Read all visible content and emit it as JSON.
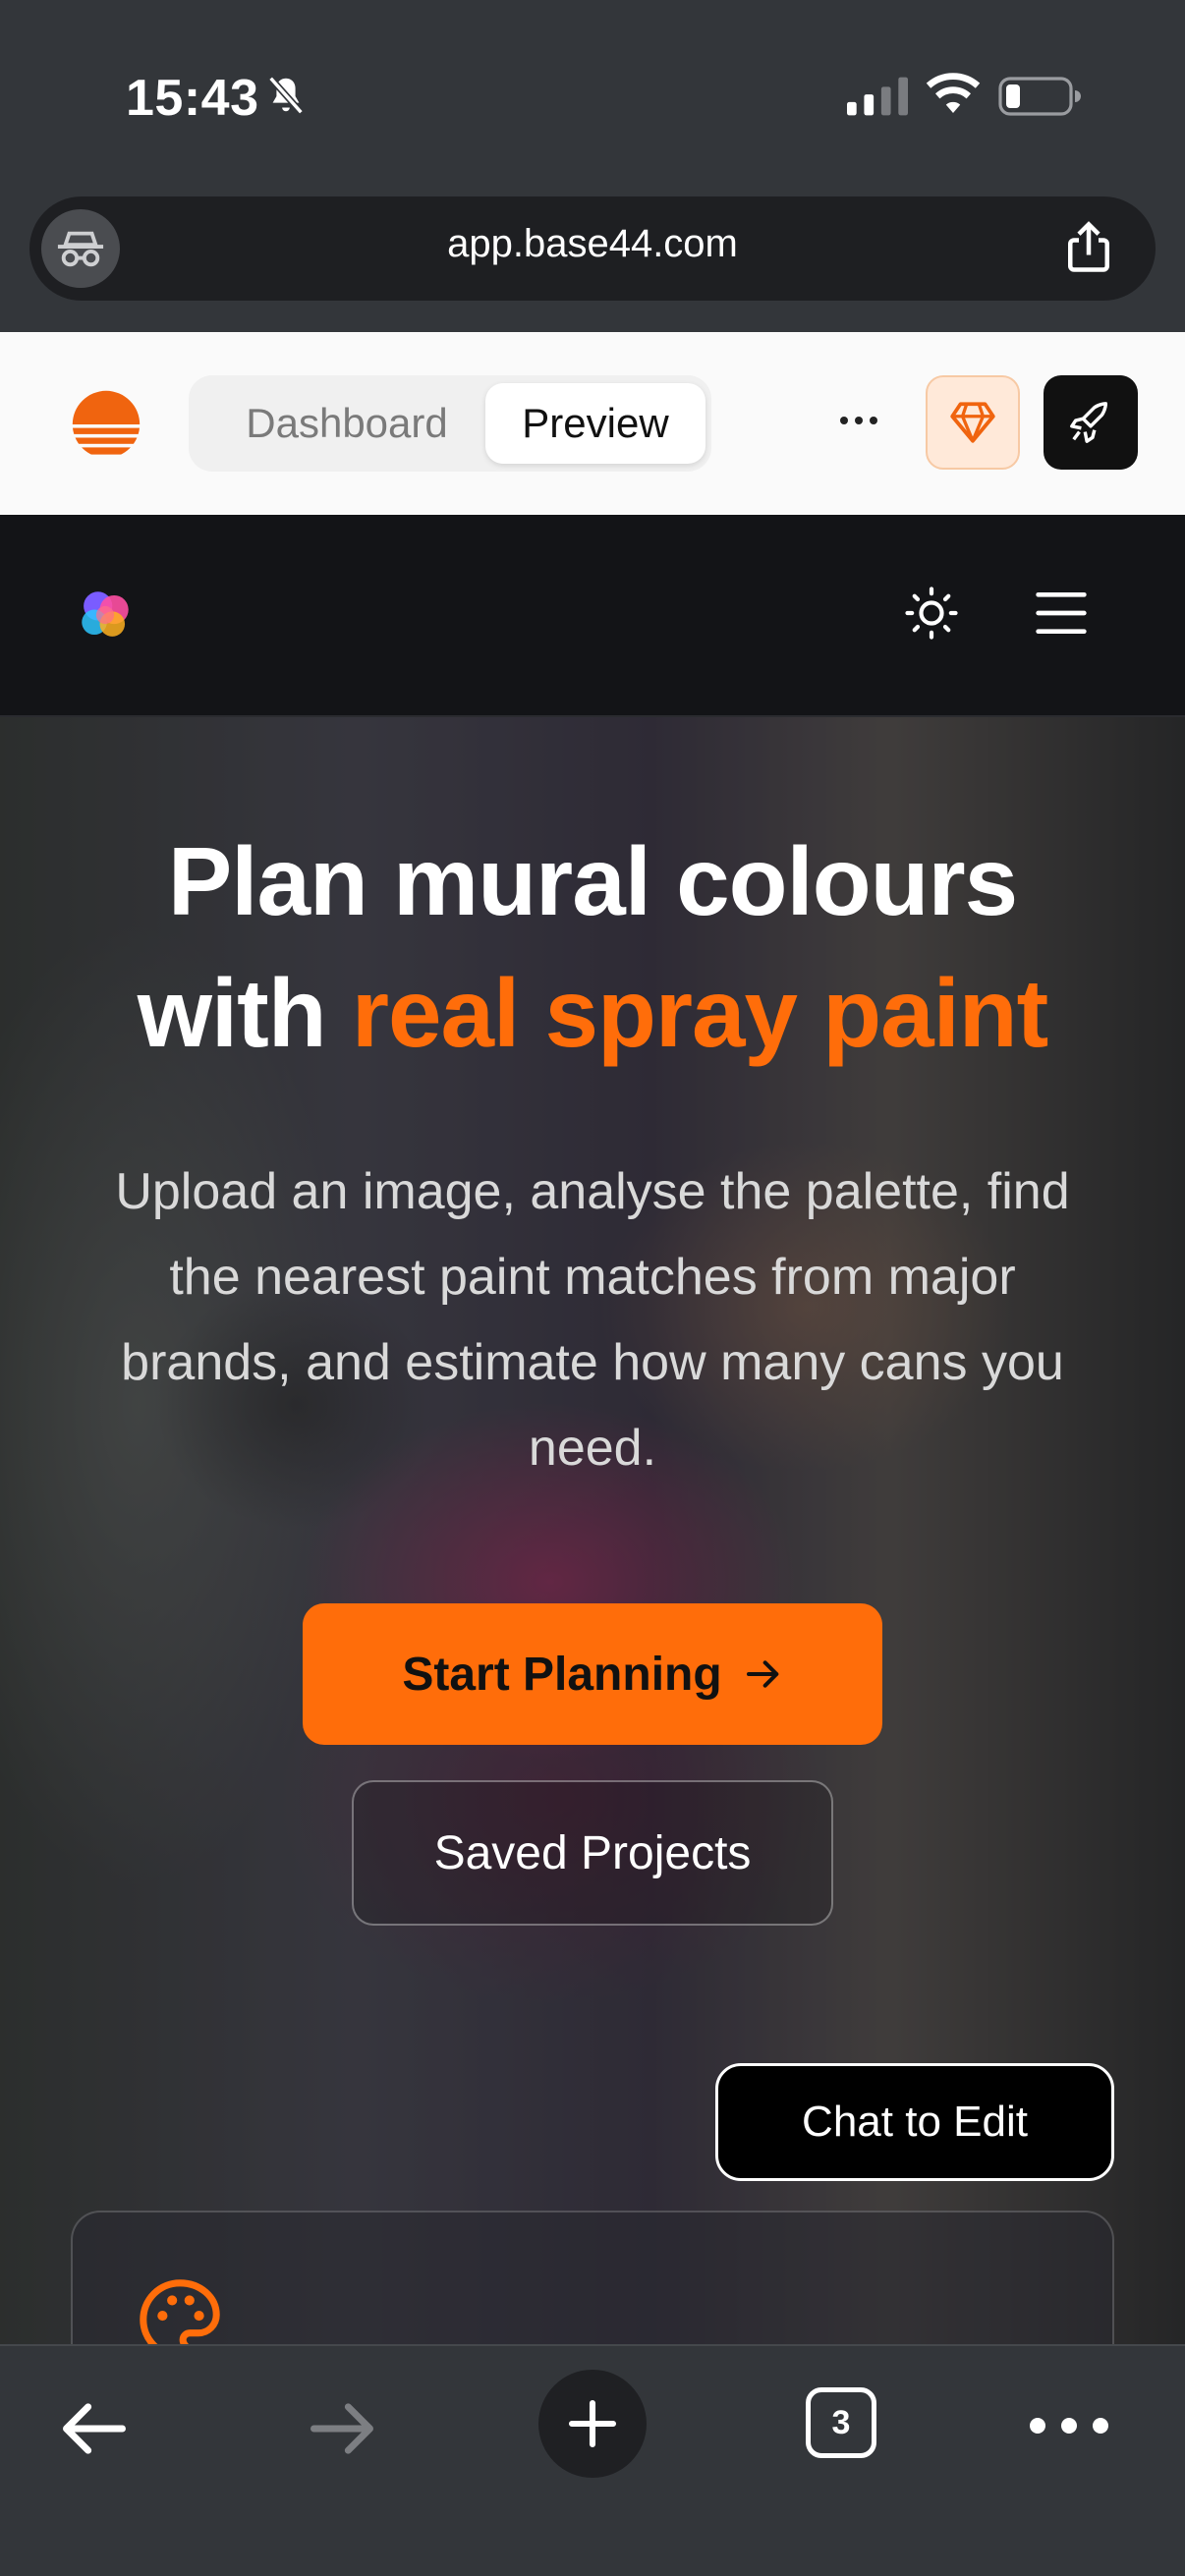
{
  "status_bar": {
    "time": "15:43"
  },
  "browser": {
    "url": "app.base44.com",
    "tab_count": "3"
  },
  "app_toolbar": {
    "tabs": [
      {
        "label": "Dashboard",
        "active": false
      },
      {
        "label": "Preview",
        "active": true
      }
    ],
    "accent_color": "#ff6d0a"
  },
  "hero": {
    "title_line1": "Plan mural colours",
    "title_line2_prefix": "with ",
    "title_line2_accent": "real spray paint",
    "subtitle": "Upload an image, analyse the palette, find the nearest paint matches from major brands, and estimate how many cans you need.",
    "primary_button": "Start Planning",
    "secondary_button": "Saved Projects"
  },
  "chat_button": "Chat to Edit",
  "icons": [
    "bell-off-icon",
    "signal-icon",
    "wifi-icon",
    "battery-icon",
    "incognito-icon",
    "share-icon",
    "more-icon",
    "gem-icon",
    "rocket-icon",
    "sun-icon",
    "menu-icon",
    "palette-icon",
    "back-icon",
    "forward-icon",
    "plus-icon",
    "tabs-icon"
  ]
}
